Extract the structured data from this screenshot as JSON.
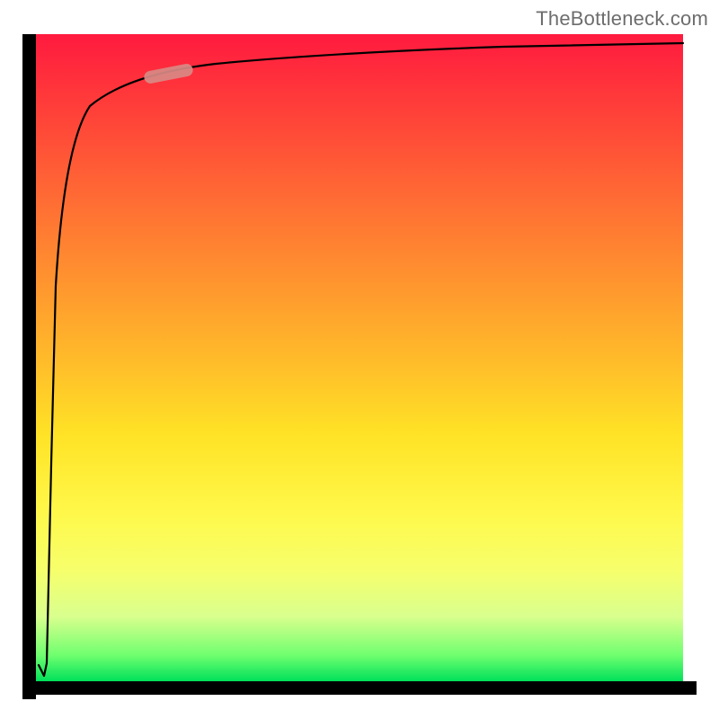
{
  "watermark": "TheBottleneck.com",
  "chart_data": {
    "type": "line",
    "title": "",
    "xlabel": "",
    "ylabel": "",
    "x": [
      0.0,
      0.01,
      0.02,
      0.03,
      0.04,
      0.05,
      0.06,
      0.08,
      0.1,
      0.12,
      0.15,
      0.2,
      0.25,
      0.3,
      0.4,
      0.5,
      0.6,
      0.7,
      0.8,
      0.9,
      1.0
    ],
    "values": [
      0.02,
      0.03,
      0.3,
      0.55,
      0.7,
      0.78,
      0.82,
      0.86,
      0.885,
      0.9,
      0.915,
      0.93,
      0.94,
      0.948,
      0.958,
      0.965,
      0.971,
      0.975,
      0.979,
      0.982,
      0.985
    ],
    "xlim": [
      0,
      1
    ],
    "ylim": [
      0,
      1
    ],
    "series": [
      {
        "name": "curve",
        "color": "#000000"
      }
    ],
    "marker": {
      "name": "highlight-segment",
      "x_range": [
        0.17,
        0.24
      ],
      "y_range": [
        0.925,
        0.938
      ],
      "color": "#d88a85"
    },
    "background_gradient": {
      "top": "#ff1a3f",
      "mid": "#ffe326",
      "bottom": "#00e05a"
    },
    "grid": false,
    "legend": false
  }
}
